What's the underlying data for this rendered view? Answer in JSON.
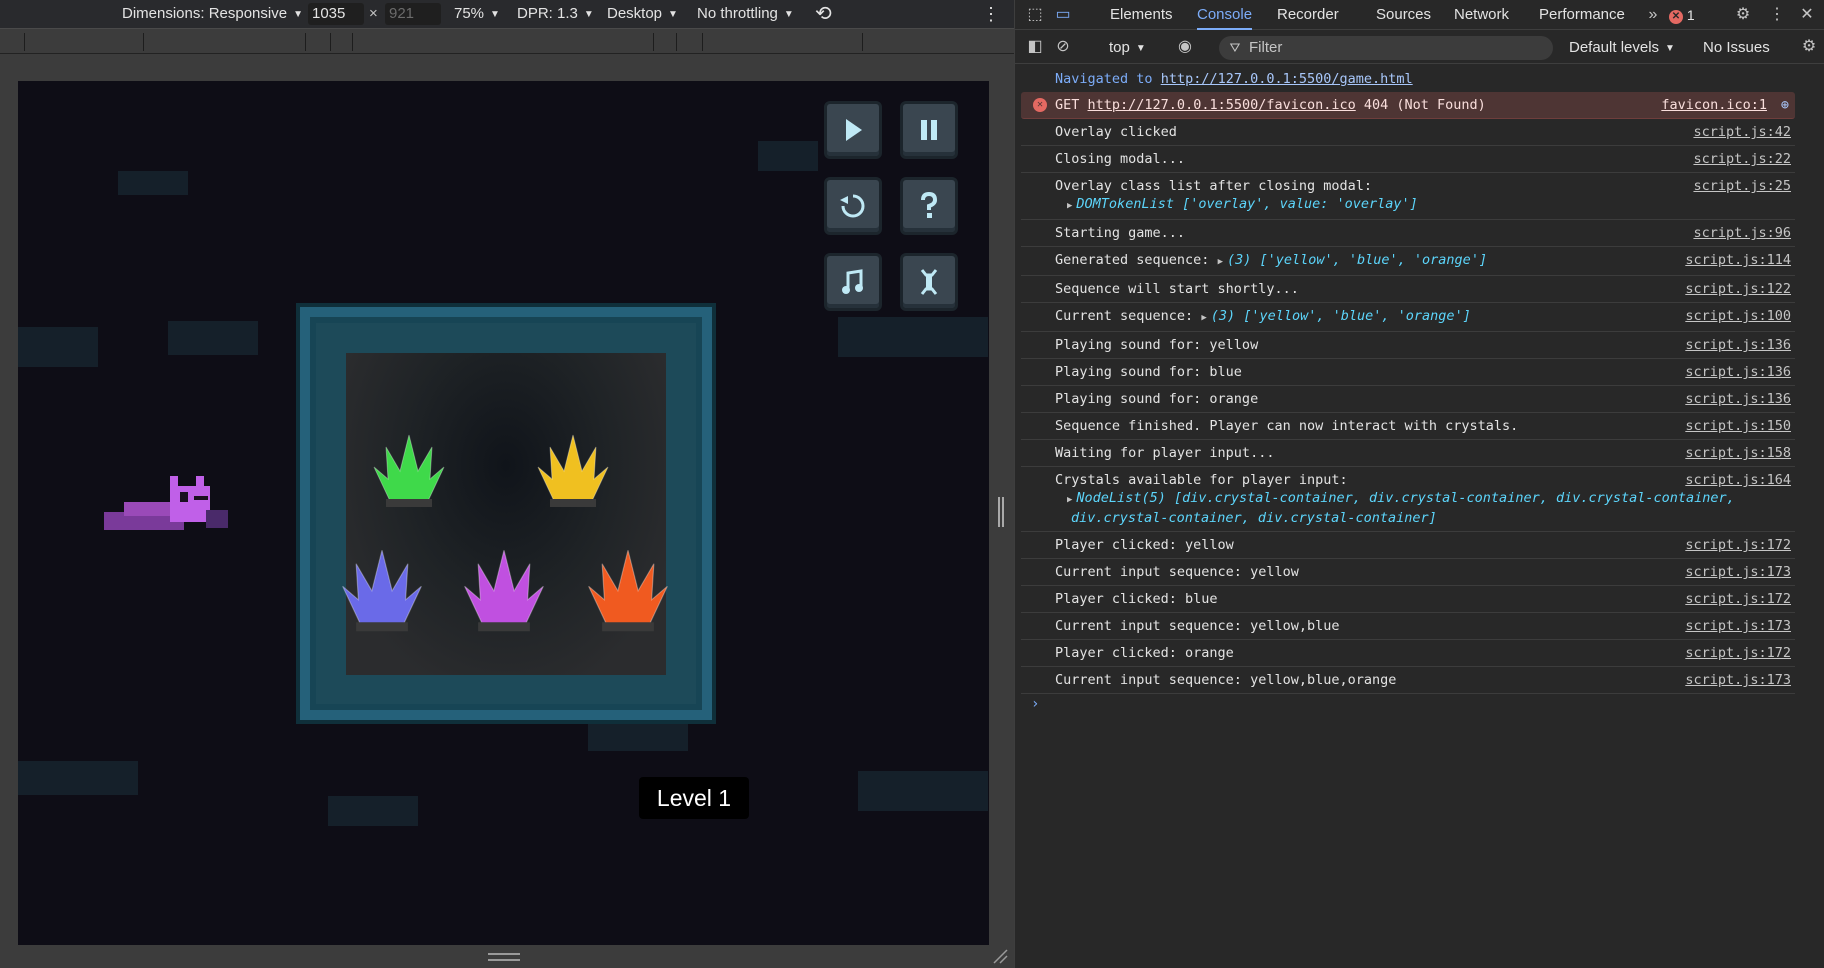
{
  "device_toolbar": {
    "dimensions_label": "Dimensions: Responsive",
    "width_value": "1035",
    "times": "×",
    "height_placeholder": "921",
    "zoom": "75%",
    "dpr": "DPR: 1.3",
    "device_type": "Desktop",
    "throttling": "No throttling"
  },
  "game": {
    "level_label": "Level 1",
    "crystals": [
      {
        "color_name": "green",
        "color": "#3fd94a"
      },
      {
        "color_name": "yellow",
        "color": "#f0c020"
      },
      {
        "color_name": "blue",
        "color": "#6a6ae8"
      },
      {
        "color_name": "purple",
        "color": "#c050e0"
      },
      {
        "color_name": "orange",
        "color": "#f05a20"
      }
    ],
    "buttons": [
      "play-icon",
      "pause-icon",
      "restart-icon",
      "help-icon",
      "music-icon",
      "settings-icon"
    ]
  },
  "devtools": {
    "tabs": [
      "Elements",
      "Console",
      "Recorder",
      "Sources",
      "Network",
      "Performance"
    ],
    "active_tab": "Console",
    "error_count": "1",
    "context": "top",
    "filter_placeholder": "Filter",
    "levels": "Default levels",
    "issues": "No Issues"
  },
  "console": {
    "nav_prefix": "Navigated to",
    "nav_url": "http://127.0.0.1:5500/game.html",
    "error_method": "GET",
    "error_url": "http://127.0.0.1:5500/favicon.ico",
    "error_status": "404 (Not Found)",
    "error_src": "favicon.ico:1",
    "messages": [
      {
        "text": "Overlay clicked",
        "src": "script.js:42"
      },
      {
        "text": "Closing modal...",
        "src": "script.js:22"
      },
      {
        "text": "Overlay class list after closing modal:",
        "src": "script.js:25",
        "sub": "DOMTokenList ['overlay', value: 'overlay']"
      },
      {
        "text": "Starting game...",
        "src": "script.js:96"
      },
      {
        "text": "Generated sequence: ",
        "src": "script.js:114",
        "inline": "(3) ['yellow', 'blue', 'orange']"
      },
      {
        "text": "Sequence will start shortly...",
        "src": "script.js:122"
      },
      {
        "text": "Current sequence: ",
        "src": "script.js:100",
        "inline": "(3) ['yellow', 'blue', 'orange']"
      },
      {
        "text": "Playing sound for: yellow",
        "src": "script.js:136"
      },
      {
        "text": "Playing sound for: blue",
        "src": "script.js:136"
      },
      {
        "text": "Playing sound for: orange",
        "src": "script.js:136"
      },
      {
        "text": "Sequence finished. Player can now interact with crystals.",
        "src": "script.js:150"
      },
      {
        "text": "Waiting for player input...",
        "src": "script.js:158"
      },
      {
        "text": "Crystals available for player input:",
        "src": "script.js:164",
        "sub": "NodeList(5) [div.crystal-container, div.crystal-container, div.crystal-container,",
        "sub2": "div.crystal-container, div.crystal-container]"
      },
      {
        "text": "Player clicked: yellow",
        "src": "script.js:172"
      },
      {
        "text": "Current input sequence: yellow",
        "src": "script.js:173"
      },
      {
        "text": "Player clicked: blue",
        "src": "script.js:172"
      },
      {
        "text": "Current input sequence: yellow,blue",
        "src": "script.js:173"
      },
      {
        "text": "Player clicked: orange",
        "src": "script.js:172"
      },
      {
        "text": "Current input sequence: yellow,blue,orange",
        "src": "script.js:173"
      }
    ],
    "prompt": "›"
  }
}
